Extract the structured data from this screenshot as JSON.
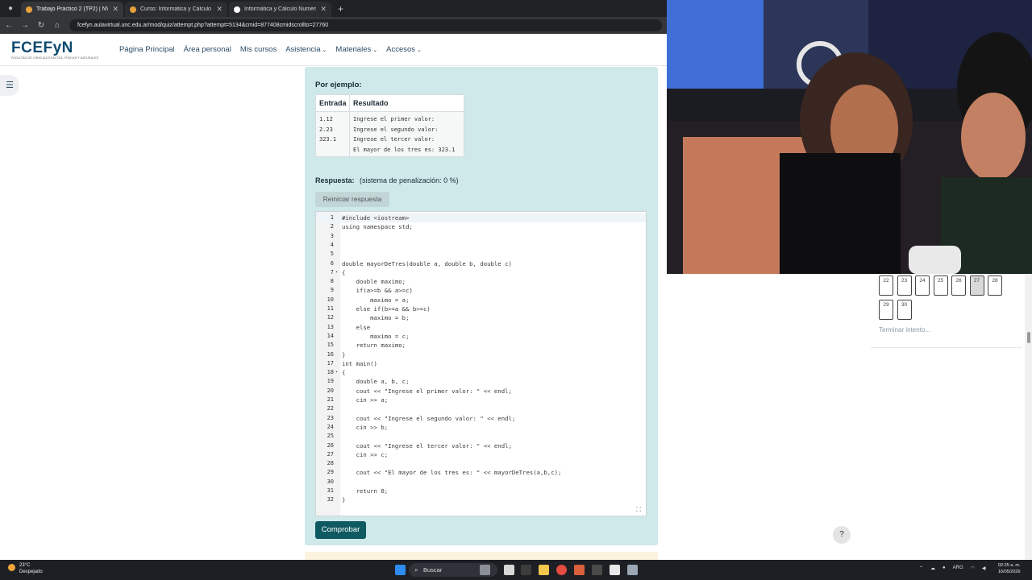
{
  "browser": {
    "tabs": [
      {
        "title": "Trabajo Práctico 2 (TP2) | NVA",
        "active": true
      },
      {
        "title": "Curso: Informática y Cálculo N",
        "active": false
      },
      {
        "title": "Informática y Cálculo Numéric",
        "active": false
      }
    ],
    "url": "fcefyn.aulavirtual.unc.edu.ar/mod/quiz/attempt.php?attempt=5134&cmid=877408cmidscrollto=27760"
  },
  "site": {
    "logo_main": "FCEFyN",
    "logo_sub": "FACULTAD DE CIENCIAS EXACTAS, FÍSICAS Y NATURALES",
    "nav": [
      {
        "label": "Página Principal",
        "dropdown": false
      },
      {
        "label": "Área personal",
        "dropdown": false
      },
      {
        "label": "Mis cursos",
        "dropdown": false
      },
      {
        "label": "Asistencia",
        "dropdown": true
      },
      {
        "label": "Materiales",
        "dropdown": true
      },
      {
        "label": "Accesos",
        "dropdown": true
      }
    ]
  },
  "question": {
    "example_heading": "Por ejemplo:",
    "col_entrada": "Entrada",
    "col_resultado": "Resultado",
    "entrada_lines": [
      "1.12",
      "2.23",
      "323.1"
    ],
    "resultado_lines": [
      "Ingrese el primer valor:",
      "Ingrese el segundo valor:",
      "Ingrese el tercer valor:",
      "El mayor de los tres es: 323.1"
    ],
    "respuesta_label": "Respuesta:",
    "penalty": "(sistema de penalización: 0 %)",
    "reset_label": "Reiniciar respuesta",
    "check_label": "Comprobar"
  },
  "editor": {
    "lines": [
      "#include <iostream>",
      "using namespace std;",
      "",
      "",
      "",
      "double mayorDeTres(double a, double b, double c)",
      "{",
      "    double maximo;",
      "    if(a>=b && a>=c)",
      "        maximo = a;",
      "    else if(b>=a && b>=c)",
      "        maximo = b;",
      "    else",
      "        maximo = c;",
      "    return maximo;",
      "}",
      "int main()",
      "{",
      "    double a, b, c;",
      "    cout << \"Ingrese el primer valor: \" << endl;",
      "    cin >> a;",
      "",
      "    cout << \"Ingrese el segundo valor: \" << endl;",
      "    cin >> b;",
      "",
      "    cout << \"Ingrese el tercer valor: \" << endl;",
      "    cin >> c;",
      "",
      "    cout << \"El mayor de los tres es: \" << mayorDeTres(a,b,c);",
      "",
      "    return 0;",
      "}"
    ]
  },
  "quiz_nav": {
    "questions": [
      "22",
      "23",
      "24",
      "25",
      "26",
      "27",
      "28",
      "29",
      "30"
    ],
    "current": "27",
    "finish_label": "Terminar intento..."
  },
  "help_label": "?",
  "taskbar": {
    "temperature": "23°C",
    "weather": "Despejado",
    "search_label": "Buscar",
    "language": "ARG",
    "time": "02:25 a. m.",
    "date": "16/05/2026"
  },
  "colors": {
    "panel_bg": "#cfe8ea",
    "check_button": "#0f5a62",
    "nav_text": "#2b4a63"
  }
}
